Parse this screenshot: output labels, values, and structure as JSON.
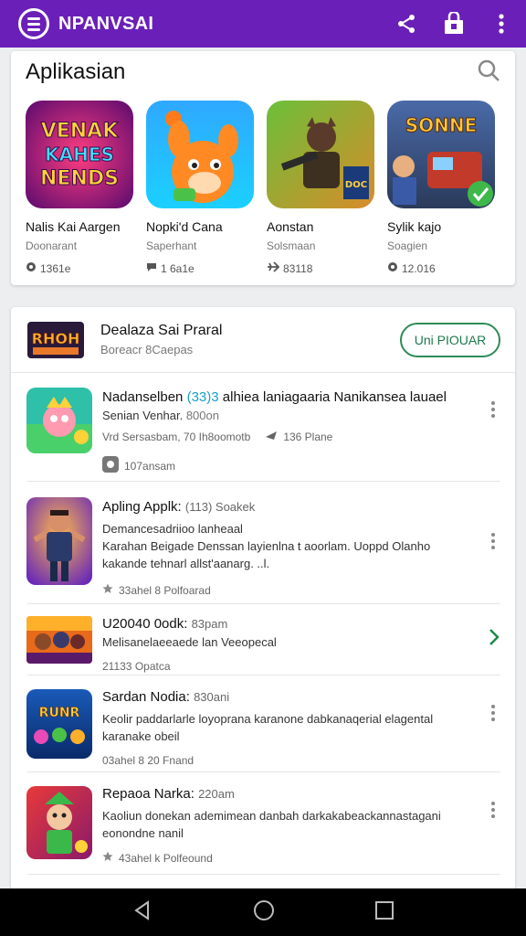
{
  "app_bar": {
    "title": "NPANVSAI",
    "menu_icon": "menu-icon",
    "share_icon": "share-icon",
    "store_icon": "store-icon",
    "more_icon": "more-vert-icon",
    "color": "#6a1fb8"
  },
  "top_card": {
    "title": "Aplikasian",
    "search_icon": "search-icon",
    "apps": [
      {
        "name": "Nalis Kai Aargen",
        "sub": "Doonarant",
        "stat": "1361e",
        "stat_icon": "storage-icon",
        "icon_text": "VENAK KAHES NENDS"
      },
      {
        "name": "Nopki'd Cana",
        "sub": "Saperhant",
        "stat": "1 6a1e",
        "stat_icon": "chat-icon",
        "icon_text": ""
      },
      {
        "name": "Aonstan",
        "sub": "Solsmaan",
        "stat": "83118",
        "stat_icon": "plane-icon",
        "icon_text": "DOC"
      },
      {
        "name": "Sylik kajo",
        "sub": "Soagien",
        "stat": "12.016",
        "stat_icon": "storage-icon",
        "icon_text": "SONNE"
      }
    ]
  },
  "featured": {
    "title": "Dealaza Sai Praral",
    "sub": "Boreacr 8Caepas",
    "button": "Uni PIOUAR",
    "icon_text": "RHOH"
  },
  "list": [
    {
      "title": "Nadanselben",
      "highlight": "(33)3",
      "title_rest": "alhiea laniagaaria Nanikansea lauael",
      "line2": "Senian Venhar.",
      "line2_dim": "800on",
      "meta1": "Vrd Sersasbam, 70 Ih8oomotb",
      "meta1b": "136 Plane",
      "meta2": "107ansam"
    },
    {
      "title": "Apling Applk:",
      "title_dim": "(113) Soakek",
      "line1": "Demancesadriioo lanheaal",
      "line2": "Karahan Beigade Denssan layienlna t aoorlam. Uoppd Olanho",
      "line3": "kakande tehnarl allst'aanarg. ..l.",
      "meta": "33ahel 8 Polfoarad"
    },
    {
      "title": "U20040 0odk:",
      "title_dim": "83pam",
      "line1": "Melisanelaeeaede lan Veeopecal",
      "meta": "21133 Opatca"
    },
    {
      "title": "Sardan Nodia:",
      "title_dim": "830ani",
      "line1": "Keolir paddarlarle loyoprana karanone dabkanaqerial elagental",
      "line2": "karanake obeil",
      "meta": "03ahel 8 20 Fnand"
    },
    {
      "title": "Repaoa Narka:",
      "title_dim": "220am",
      "line1": "Kaoliun donekan ademimean danbah darkakabeackannastagani",
      "line2": "eonondne nanil",
      "meta": "43ahel k Polfeound"
    }
  ],
  "nav": {
    "back_icon": "back-icon",
    "home_icon": "home-icon",
    "recents_icon": "recents-icon"
  }
}
